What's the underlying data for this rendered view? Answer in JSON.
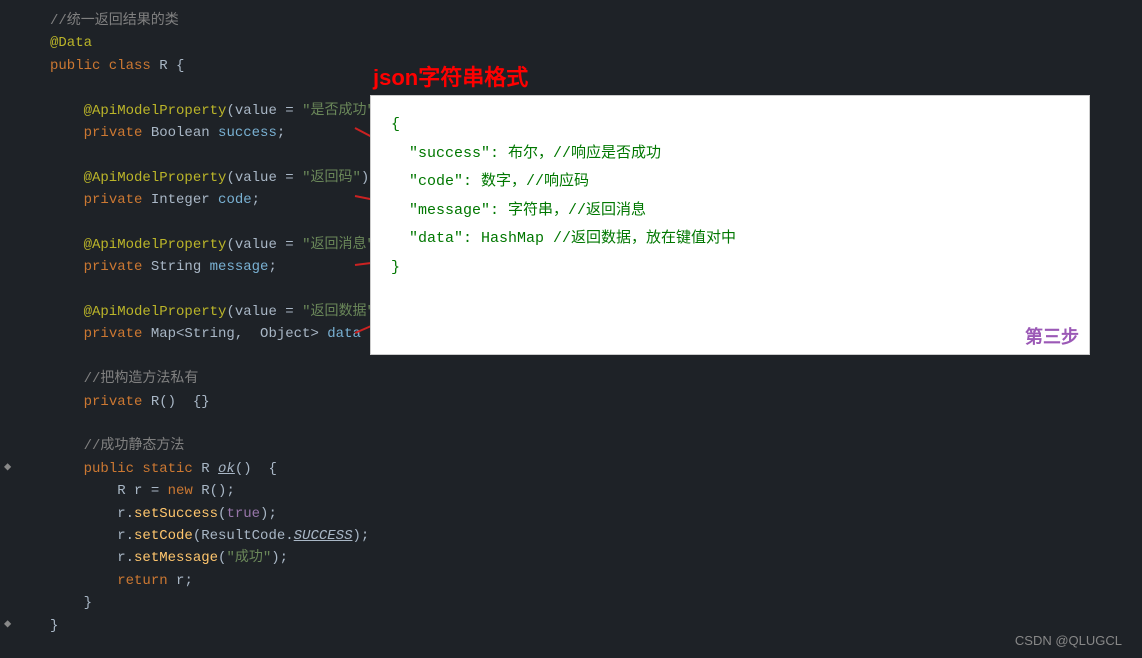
{
  "title": "Java Code Editor",
  "code_lines": [
    {
      "num": "",
      "content": "//统一返回结果的类",
      "type": "comment"
    },
    {
      "num": "",
      "content": "@Data",
      "type": "annotation"
    },
    {
      "num": "",
      "content": "public class R {",
      "type": "code"
    },
    {
      "num": "",
      "content": "",
      "type": "blank"
    },
    {
      "num": "",
      "content": "    @ApiModelProperty(value = \"是否成功\")",
      "type": "annotation"
    },
    {
      "num": "",
      "content": "    private Boolean success;",
      "type": "code"
    },
    {
      "num": "",
      "content": "",
      "type": "blank"
    },
    {
      "num": "",
      "content": "    @ApiModelProperty(value = \"返回码\")",
      "type": "annotation"
    },
    {
      "num": "",
      "content": "    private Integer code;",
      "type": "code"
    },
    {
      "num": "",
      "content": "",
      "type": "blank"
    },
    {
      "num": "",
      "content": "    @ApiModelProperty(value = \"返回消息\")",
      "type": "annotation"
    },
    {
      "num": "",
      "content": "    private String message;",
      "type": "code"
    },
    {
      "num": "",
      "content": "",
      "type": "blank"
    },
    {
      "num": "",
      "content": "    @ApiModelProperty(value = \"返回数据\")",
      "type": "annotation"
    },
    {
      "num": "",
      "content": "    private Map<String, Object> data = new HashMap<>();",
      "type": "code"
    },
    {
      "num": "",
      "content": "",
      "type": "blank"
    },
    {
      "num": "",
      "content": "    //把构造方法私有",
      "type": "comment"
    },
    {
      "num": "",
      "content": "    private R()  {}",
      "type": "code"
    },
    {
      "num": "",
      "content": "",
      "type": "blank"
    },
    {
      "num": "",
      "content": "    //成功静态方法",
      "type": "comment"
    },
    {
      "num": "",
      "content": "    public static R ok()  {",
      "type": "code"
    },
    {
      "num": "",
      "content": "        R r = new R();",
      "type": "code"
    },
    {
      "num": "",
      "content": "        r.setSuccess(true);",
      "type": "code"
    },
    {
      "num": "",
      "content": "        r.setCode(ResultCode.SUCCESS);",
      "type": "code"
    },
    {
      "num": "",
      "content": "        r.setMessage(\"成功\");",
      "type": "code"
    },
    {
      "num": "",
      "content": "        return r;",
      "type": "code"
    },
    {
      "num": "",
      "content": "    }",
      "type": "code"
    },
    {
      "num": "",
      "content": "}",
      "type": "code"
    }
  ],
  "json_popup": {
    "title": "json字符串格式",
    "lines": [
      "{",
      "  \"success\": 布尔，//响应是否成功",
      "  \"code\": 数字，//响应码",
      "  \"message\": 字符串，//返回消息",
      "  \"data\": HashMap //返回数据，放在键值对中",
      "}"
    ]
  },
  "step_label": "第三步 ",
  "bottom_label": "CSDN @QLUGCL"
}
